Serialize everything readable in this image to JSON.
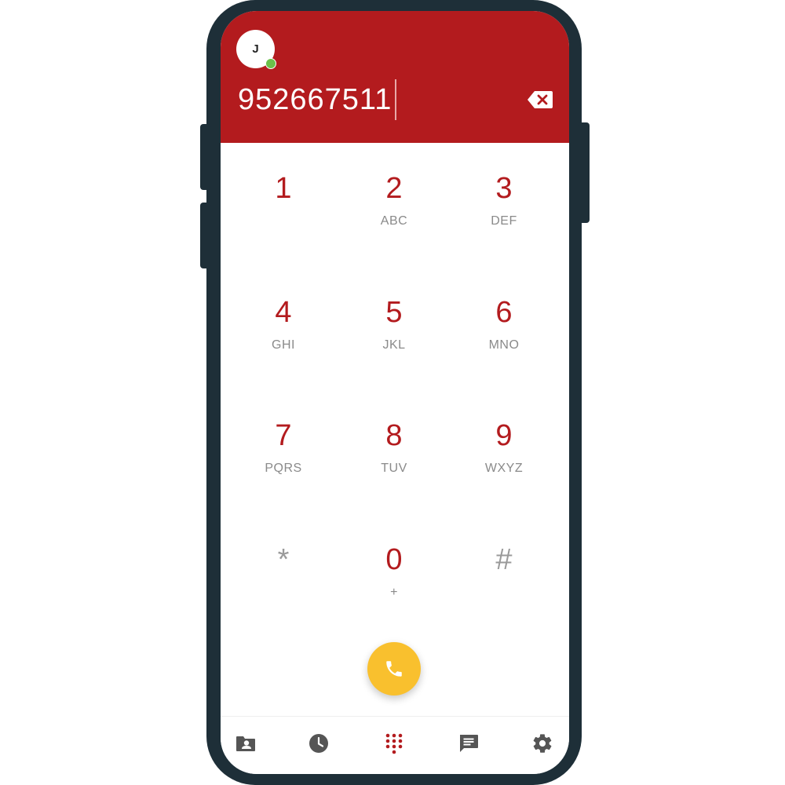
{
  "header": {
    "avatar_initial": "J",
    "presence": "online",
    "dialed_number": "952667511",
    "backspace_icon": "backspace-icon"
  },
  "keypad": {
    "keys": [
      {
        "digit": "1",
        "letters": ""
      },
      {
        "digit": "2",
        "letters": "ABC"
      },
      {
        "digit": "3",
        "letters": "DEF"
      },
      {
        "digit": "4",
        "letters": "GHI"
      },
      {
        "digit": "5",
        "letters": "JKL"
      },
      {
        "digit": "6",
        "letters": "MNO"
      },
      {
        "digit": "7",
        "letters": "PQRS"
      },
      {
        "digit": "8",
        "letters": "TUV"
      },
      {
        "digit": "9",
        "letters": "WXYZ"
      },
      {
        "digit": "*",
        "letters": ""
      },
      {
        "digit": "0",
        "letters": "+"
      },
      {
        "digit": "#",
        "letters": ""
      }
    ]
  },
  "call_button": {
    "icon": "phone-icon"
  },
  "bottom_nav": {
    "items": [
      {
        "icon": "contacts-icon",
        "active": false
      },
      {
        "icon": "recents-clock-icon",
        "active": false
      },
      {
        "icon": "dialpad-icon",
        "active": true
      },
      {
        "icon": "messages-icon",
        "active": false
      },
      {
        "icon": "settings-gear-icon",
        "active": false
      }
    ]
  },
  "colors": {
    "brand_red": "#b31b1e",
    "call_yellow": "#f9c02e",
    "frame": "#1e2f38",
    "nav_icon": "#555555",
    "presence_green": "#6cc04a"
  }
}
